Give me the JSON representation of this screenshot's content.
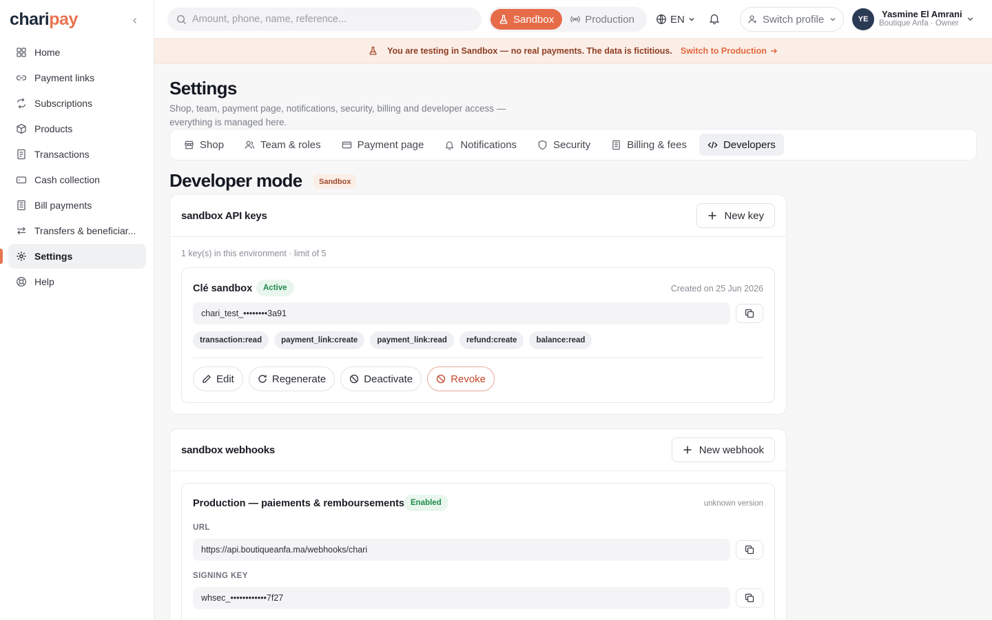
{
  "brand": {
    "name_main": "chari",
    "name_accent": "pay",
    "accent_color": "#e8734f"
  },
  "sidebar": {
    "items": [
      {
        "label": "Home",
        "icon": "grid-icon"
      },
      {
        "label": "Payment links",
        "icon": "link-icon"
      },
      {
        "label": "Subscriptions",
        "icon": "repeat-icon"
      },
      {
        "label": "Products",
        "icon": "package-icon"
      },
      {
        "label": "Transactions",
        "icon": "receipt-icon"
      },
      {
        "label": "Cash collection",
        "icon": "wallet-icon"
      },
      {
        "label": "Bill payments",
        "icon": "bill-icon"
      },
      {
        "label": "Transfers & beneficiar...",
        "icon": "transfer-icon"
      },
      {
        "label": "Settings",
        "icon": "gear-icon",
        "active": true
      },
      {
        "label": "Help",
        "icon": "lifebuoy-icon"
      }
    ]
  },
  "topbar": {
    "search_placeholder": "Amount, phone, name, reference...",
    "env_sandbox": "Sandbox",
    "env_production": "Production",
    "language": "EN",
    "switch_profile": "Switch profile",
    "user": {
      "initials": "YE",
      "name": "Yasmine El Amrani",
      "role": "Boutique Anfa · Owner"
    }
  },
  "banner": {
    "message": "You are testing in Sandbox — no real payments. The data is fictitious.",
    "link": "Switch to Production"
  },
  "page": {
    "title": "Settings",
    "description": "Shop, team, payment page, notifications, security, billing and developer access — everything is managed here.",
    "tabs": [
      {
        "label": "Shop",
        "icon": "store-icon"
      },
      {
        "label": "Team & roles",
        "icon": "users-icon"
      },
      {
        "label": "Payment page",
        "icon": "card-icon"
      },
      {
        "label": "Notifications",
        "icon": "bell-icon"
      },
      {
        "label": "Security",
        "icon": "shield-icon"
      },
      {
        "label": "Billing & fees",
        "icon": "document-icon"
      },
      {
        "label": "Developers",
        "icon": "code-icon",
        "active": true
      }
    ]
  },
  "developer": {
    "title": "Developer mode",
    "badge": "Sandbox",
    "api_keys": {
      "title": "sandbox API keys",
      "new_button": "New key",
      "summary": "1 key(s) in this environment · limit of 5",
      "key": {
        "name": "Clé sandbox",
        "status": "Active",
        "created": "Created on 25 Jun 2026",
        "value": "chari_test_••••••••3a91",
        "scopes": [
          "transaction:read",
          "payment_link:create",
          "payment_link:read",
          "refund:create",
          "balance:read"
        ],
        "actions": {
          "edit": "Edit",
          "regenerate": "Regenerate",
          "deactivate": "Deactivate",
          "revoke": "Revoke"
        }
      }
    },
    "webhooks": {
      "title": "sandbox webhooks",
      "new_button": "New webhook",
      "hook": {
        "name": "Production — paiements & remboursements",
        "status": "Enabled",
        "version": "unknown version",
        "url_label": "URL",
        "url": "https://api.boutiqueanfa.ma/webhooks/chari",
        "signing_label": "SIGNING KEY",
        "signing_key": "whsec_••••••••••••7f27"
      }
    }
  }
}
